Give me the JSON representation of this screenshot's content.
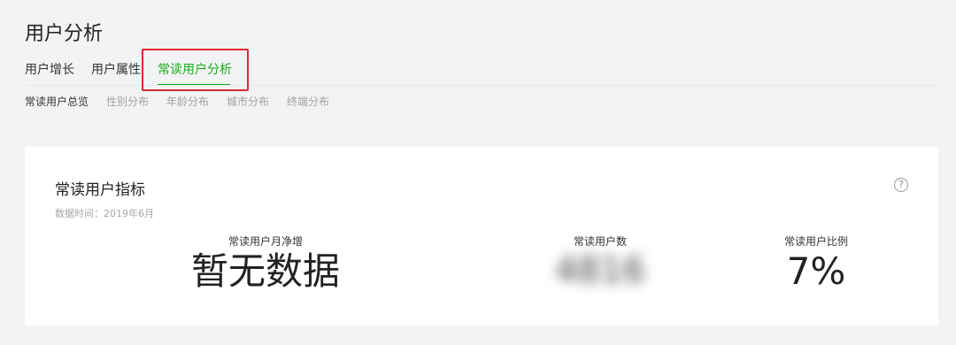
{
  "page": {
    "title": "用户分析"
  },
  "tabs": [
    {
      "label": "用户增长",
      "active": false
    },
    {
      "label": "用户属性",
      "active": false
    },
    {
      "label": "常读用户分析",
      "active": true
    }
  ],
  "subtabs": [
    {
      "label": "常读用户总览",
      "active": true
    },
    {
      "label": "性别分布",
      "active": false
    },
    {
      "label": "年龄分布",
      "active": false
    },
    {
      "label": "城市分布",
      "active": false
    },
    {
      "label": "终端分布",
      "active": false
    }
  ],
  "card": {
    "title": "常读用户指标",
    "help_icon": "?",
    "data_time_label": "数据时间：",
    "data_time_value": "2019年6月",
    "metrics": [
      {
        "label": "常读用户月净增",
        "value": "暂无数据"
      },
      {
        "label": "常读用户数",
        "value": "4816"
      },
      {
        "label": "常读用户比例",
        "value": "7%"
      }
    ]
  },
  "colors": {
    "accent": "#1aad19",
    "highlight": "#e0282e",
    "background": "#f2f3f5"
  }
}
